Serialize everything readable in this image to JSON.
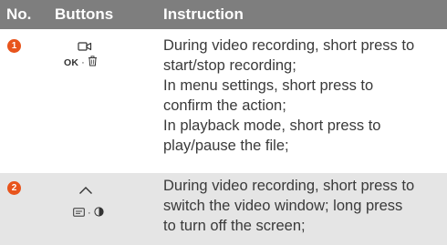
{
  "header": {
    "no_label": "No.",
    "buttons_label": "Buttons",
    "instruction_label": "Instruction"
  },
  "colors": {
    "header_bg": "#7e7e7e",
    "number_badge": "#e8541c",
    "row_alt_bg": "#e5e5e5"
  },
  "rows": [
    {
      "number": "1",
      "buttons": {
        "top_icon": "video-camera-icon",
        "ok_label": "OK",
        "separator": "·",
        "bottom_icon": "trash-icon"
      },
      "instruction": "During video recording, short press to\nstart/stop recording;\nIn menu settings, short press to\nconfirm the action;\nIn playback mode, short press to\nplay/pause the file;"
    },
    {
      "number": "2",
      "buttons": {
        "top_icon": "chevron-up-icon",
        "left_icon": "window-icon",
        "separator": "·",
        "right_icon": "screen-contrast-icon"
      },
      "instruction": "During video recording, short press to\nswitch the video window; long press\nto turn off the screen;"
    }
  ]
}
